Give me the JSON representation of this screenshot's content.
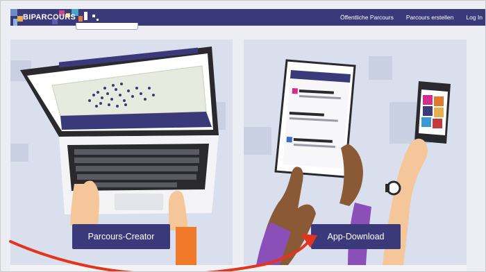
{
  "brand": {
    "name": "BIPARCOURS"
  },
  "nav": {
    "links": [
      "Öffentliche Parcours",
      "Parcours erstellen",
      "Log In"
    ]
  },
  "tiles": {
    "creator_label": "Parcours-Creator",
    "download_label": "App-Download"
  },
  "colors": {
    "navbar": "#3a3a7a",
    "panel": "#d9dfec",
    "button": "#3a3a7a",
    "annotation_arrow": "#e3351e"
  },
  "icons": [
    "laptop-illustration",
    "tablet-illustration",
    "smartphone-illustration",
    "red-arrow-annotation"
  ]
}
